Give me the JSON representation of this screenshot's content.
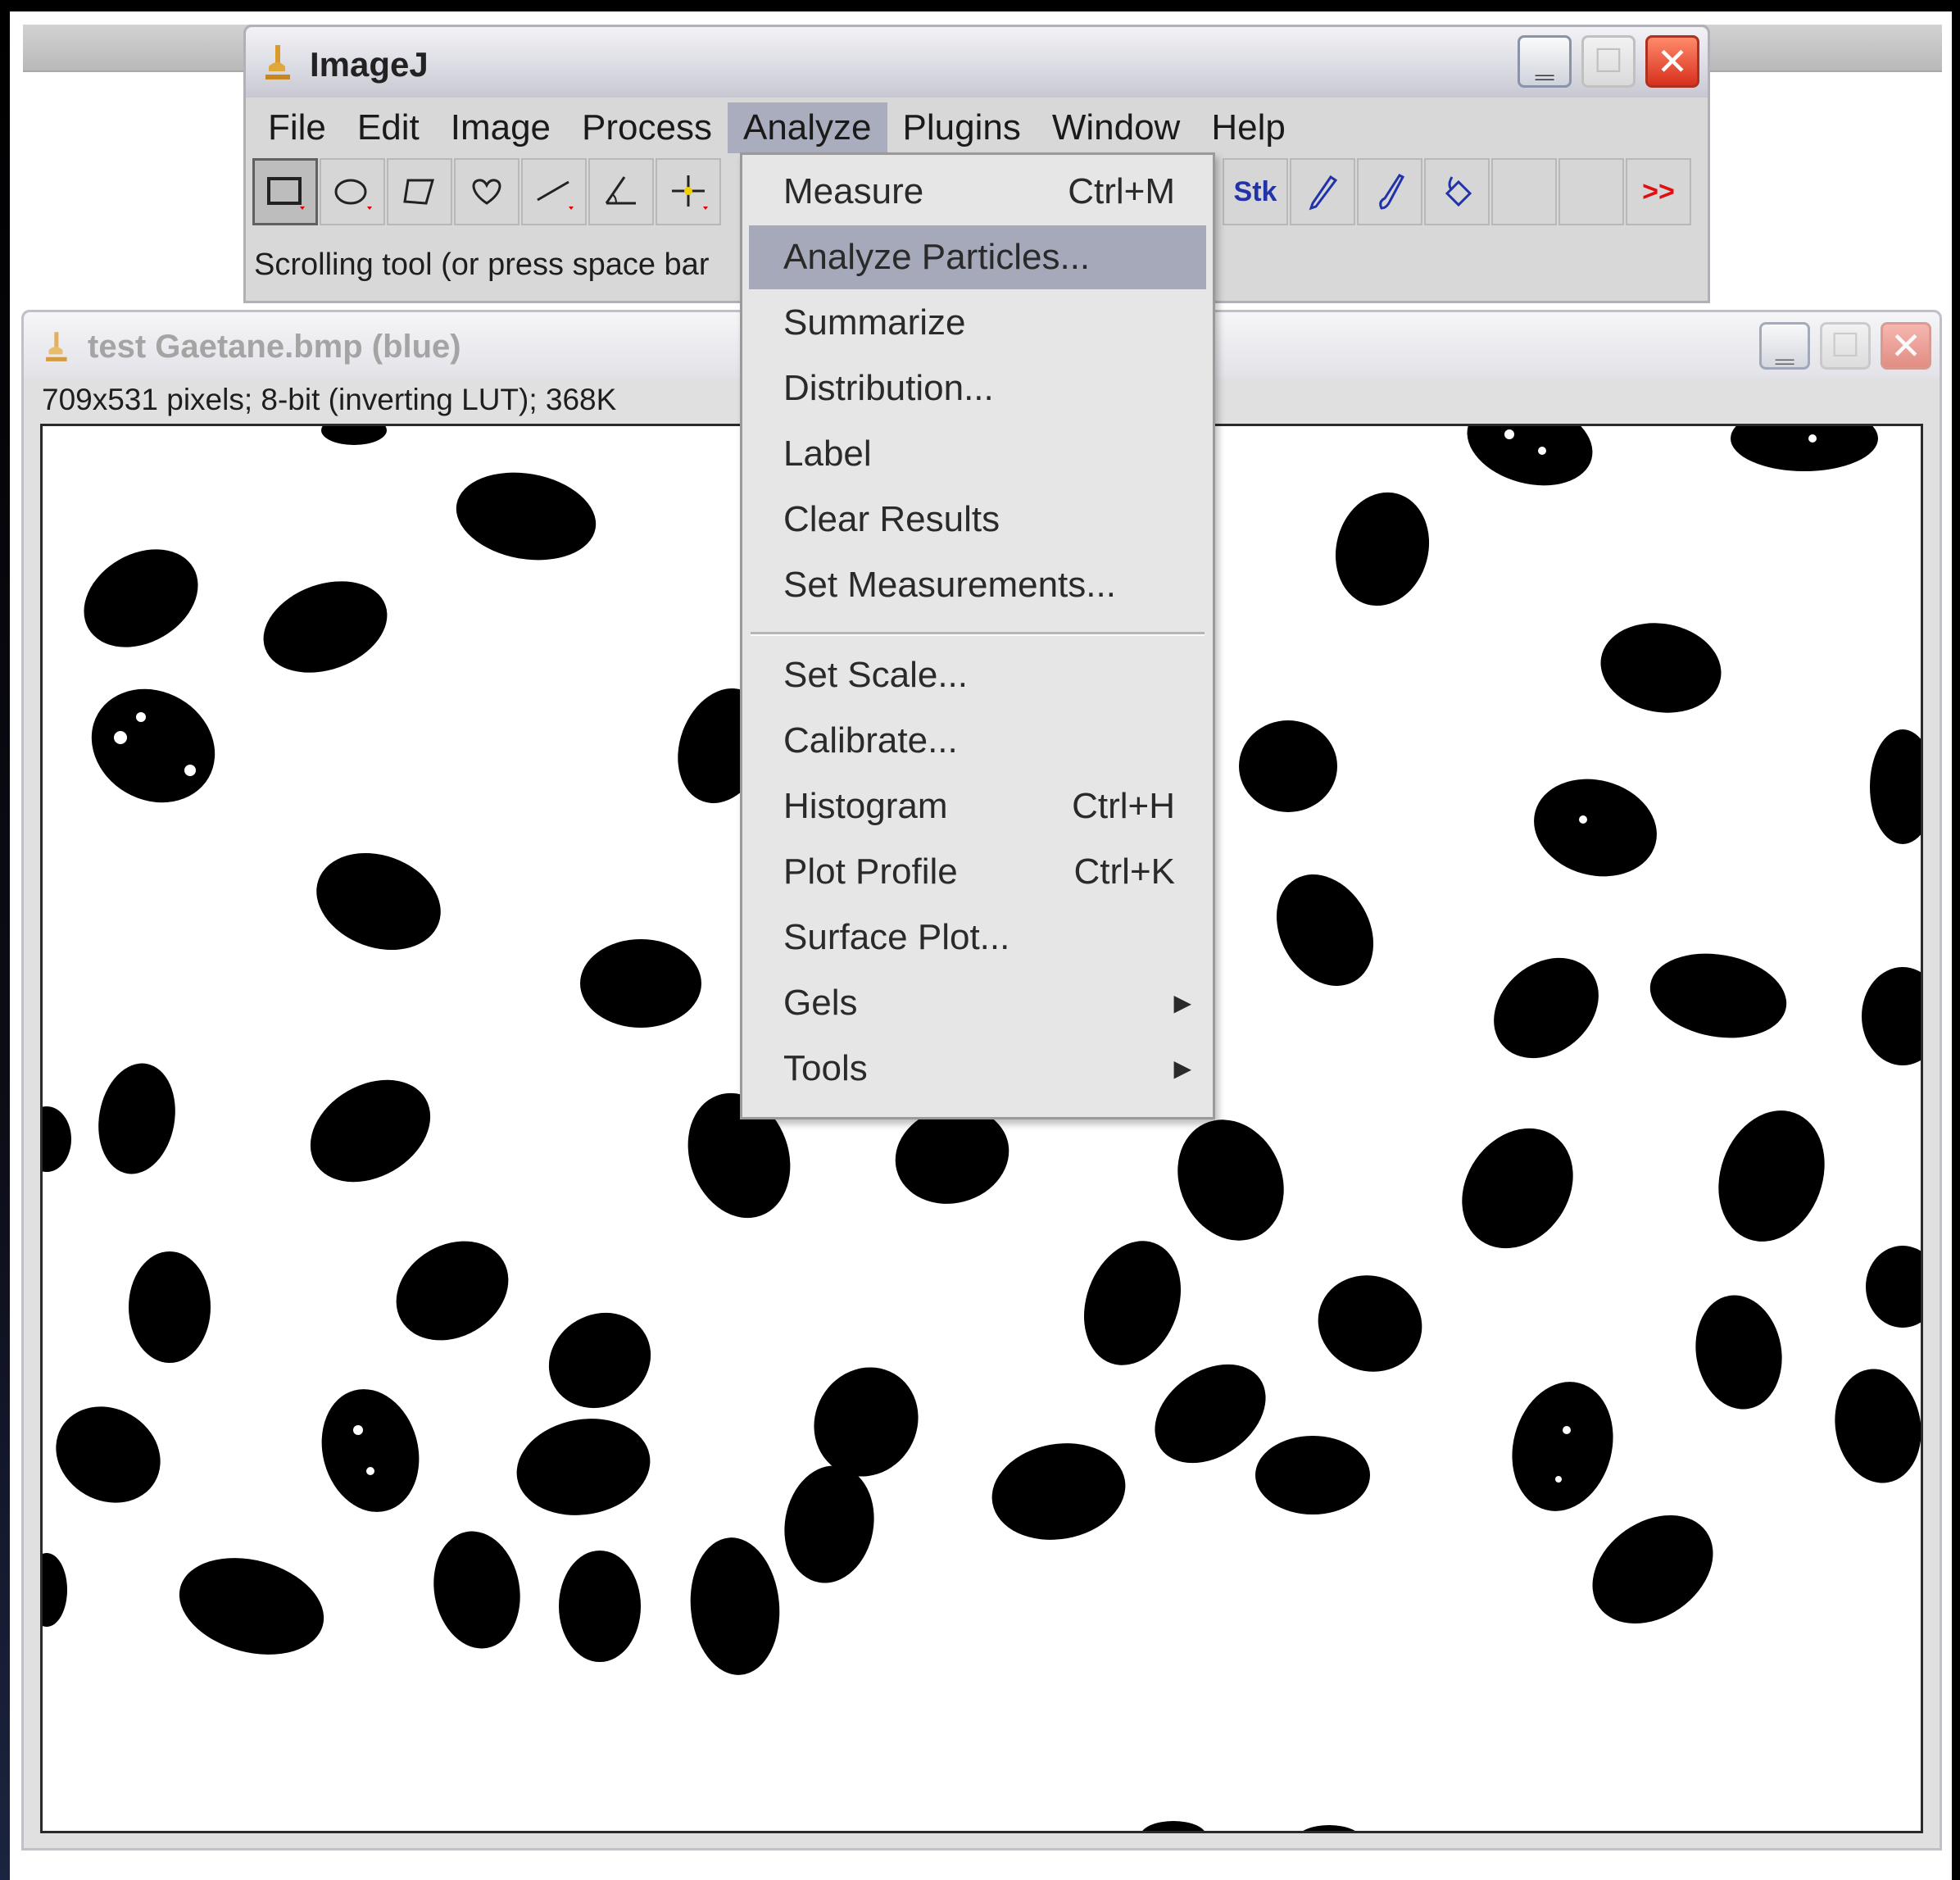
{
  "main_window": {
    "title": "ImageJ",
    "menu": [
      "File",
      "Edit",
      "Image",
      "Process",
      "Analyze",
      "Plugins",
      "Window",
      "Help"
    ],
    "active_menu_index": 4,
    "toolbar": {
      "stk_label": "Stk",
      "more_label": ">>",
      "icons": [
        "rectangle-tool-icon",
        "oval-tool-icon",
        "polygon-tool-icon",
        "freehand-tool-icon",
        "line-tool-icon",
        "angle-tool-icon",
        "point-tool-icon",
        "stacks-icon",
        "pencil-icon",
        "brush-icon",
        "flood-fill-icon"
      ]
    },
    "status": "Scrolling tool (or press space bar"
  },
  "image_window": {
    "title": "test Gaetane.bmp (blue)",
    "info": "709x531 pixels; 8-bit (inverting LUT); 368K"
  },
  "analyze_menu": {
    "items": [
      {
        "label": "Measure",
        "shortcut": "Ctrl+M"
      },
      {
        "label": "Analyze Particles...",
        "shortcut": "",
        "highlighted": true
      },
      {
        "label": "Summarize",
        "shortcut": ""
      },
      {
        "label": "Distribution...",
        "shortcut": ""
      },
      {
        "label": "Label",
        "shortcut": ""
      },
      {
        "label": "Clear Results",
        "shortcut": ""
      },
      {
        "label": "Set Measurements...",
        "shortcut": ""
      },
      {
        "label": "Set Scale...",
        "shortcut": ""
      },
      {
        "label": "Calibrate...",
        "shortcut": ""
      },
      {
        "label": "Histogram",
        "shortcut": "Ctrl+H"
      },
      {
        "label": "Plot Profile",
        "shortcut": "Ctrl+K"
      },
      {
        "label": "Surface Plot...",
        "shortcut": ""
      },
      {
        "label": "Gels",
        "shortcut": "",
        "submenu": true
      },
      {
        "label": "Tools",
        "shortcut": "",
        "submenu": true
      }
    ]
  },
  "colors": {
    "menu_highlight": "#a5a9ba",
    "particle": "#000000",
    "canvas_bg": "#ffffff",
    "close_button": "#d8301e"
  }
}
